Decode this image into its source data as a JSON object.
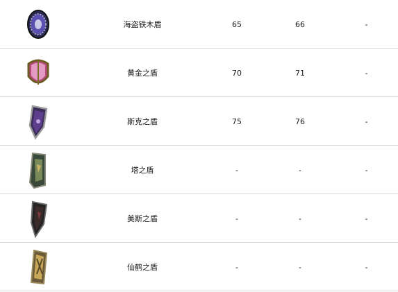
{
  "colors": {
    "divider": "#d9d9d9",
    "text": "#1a1a1a"
  },
  "rows": [
    {
      "icon": "round-blue-shield-icon",
      "name": "海盗铁木盾",
      "col2": "65",
      "col3": "66",
      "col4": "-"
    },
    {
      "icon": "gold-pink-shield-icon",
      "name": "黄金之盾",
      "col2": "70",
      "col3": "71",
      "col4": "-"
    },
    {
      "icon": "kite-purple-shield-icon",
      "name": "斯克之盾",
      "col2": "75",
      "col3": "76",
      "col4": "-"
    },
    {
      "icon": "tower-shield-icon",
      "name": "塔之盾",
      "col2": "-",
      "col3": "-",
      "col4": "-"
    },
    {
      "icon": "dark-heater-shield-icon",
      "name": "美斯之盾",
      "col2": "-",
      "col3": "-",
      "col4": "-"
    },
    {
      "icon": "crane-gold-shield-icon",
      "name": "仙鹤之盾",
      "col2": "-",
      "col3": "-",
      "col4": "-"
    }
  ]
}
